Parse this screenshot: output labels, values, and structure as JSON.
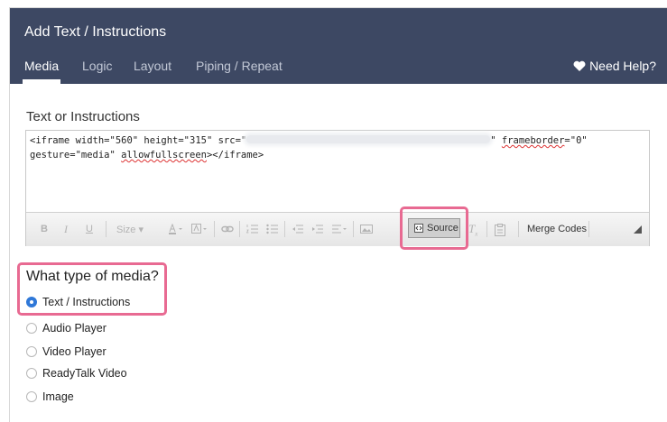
{
  "header": {
    "title": "Add Text / Instructions",
    "tabs": [
      {
        "label": "Media",
        "active": true
      },
      {
        "label": "Logic"
      },
      {
        "label": "Layout"
      },
      {
        "label": "Piping / Repeat"
      }
    ],
    "help_label": "Need Help?",
    "bg_color": "#3d4863"
  },
  "editor": {
    "label": "Text or Instructions",
    "code": {
      "part1": "<iframe width=\"560\" height=\"315\" src=\"",
      "part2": "\" ",
      "part3": "frameborder",
      "part4": "=\"0\"",
      "line2a": "gesture=\"media\" ",
      "line2b": "allowfullscreen",
      "line2c": "></iframe>"
    },
    "toolbar": {
      "bold": "B",
      "italic": "I",
      "underline": "U",
      "size": "Size",
      "source_label": "Source",
      "merge_label": "Merge Codes"
    }
  },
  "media": {
    "question": "What type of media?",
    "options": [
      {
        "label": "Text / Instructions",
        "checked": true
      },
      {
        "label": "Audio Player"
      },
      {
        "label": "Video Player"
      },
      {
        "label": "ReadyTalk Video"
      },
      {
        "label": "Image"
      }
    ],
    "highlight_color": "#e86a92",
    "selected_color": "#2f78d8"
  }
}
